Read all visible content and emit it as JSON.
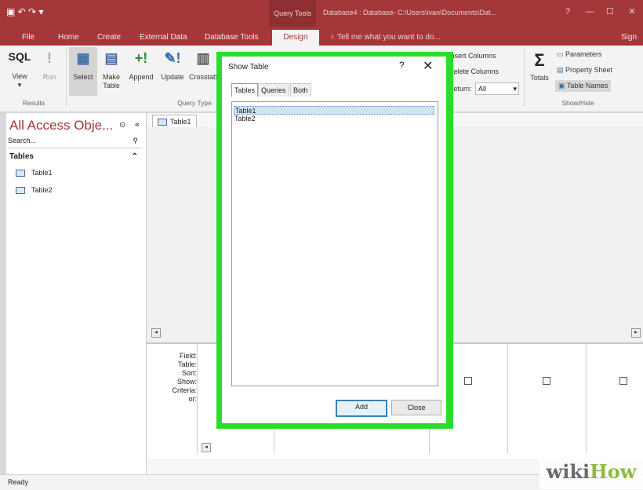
{
  "titlebar": {
    "query_tools": "Query Tools",
    "doc_title": "Database4 : Database- C:\\Users\\ivan\\Documents\\Dat..."
  },
  "tabs": [
    "File",
    "Home",
    "Create",
    "External Data",
    "Database Tools",
    "Design"
  ],
  "tell_me": "Tell me what you want to do...",
  "sign_in": "Sign in",
  "ribbon": {
    "results": {
      "view_icon": "SQL",
      "view": "View",
      "run_icon": "!",
      "run": "Run",
      "group": "Results"
    },
    "query_type": {
      "select": "Select",
      "make_table": "Make Table",
      "append": "Append",
      "update": "Update",
      "crosstab": "Crosstab",
      "group": "Query Type"
    },
    "query_setup": {
      "insert_columns": "Insert Columns",
      "delete_columns": "Delete Columns",
      "return_label": "Return:",
      "return_value": "All"
    },
    "show_hide": {
      "totals_icon": "Σ",
      "totals": "Totals",
      "parameters": "Parameters",
      "property_sheet": "Property Sheet",
      "table_names": "Table Names",
      "group": "Show/Hide"
    }
  },
  "nav": {
    "title": "All Access Obje...",
    "search_placeholder": "Search...",
    "section": "Tables",
    "items": [
      "Table1",
      "Table2"
    ]
  },
  "document": {
    "tab": "Table1",
    "grid_labels": [
      "Field:",
      "Table:",
      "Sort:",
      "Show:",
      "Criteria:",
      "or:"
    ]
  },
  "dialog": {
    "title": "Show Table",
    "help": "?",
    "close": "✕",
    "tabs": [
      "Tables",
      "Queries",
      "Both"
    ],
    "items": [
      "Table1",
      "Table2"
    ],
    "add": "Add",
    "close_button": "Close"
  },
  "status": "Ready",
  "watermark": {
    "part1": "wiki",
    "part2": "How"
  },
  "colors": {
    "access_red": "#a4373a",
    "highlight_outline": "#2bdc2f"
  }
}
